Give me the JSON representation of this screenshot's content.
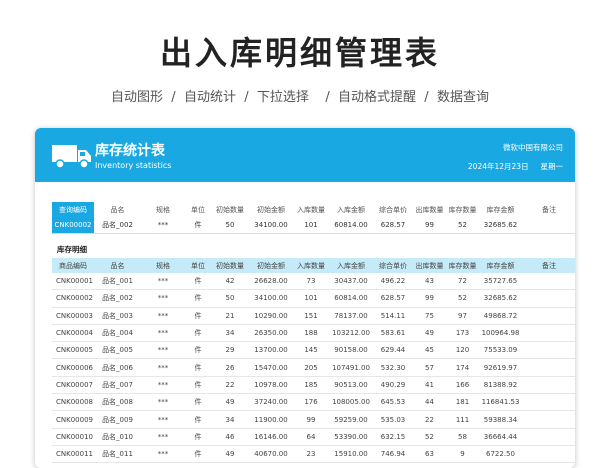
{
  "title": "出入库明细管理表",
  "subtitle": "自动图形  /  自动统计  /  下拉选择    /  自动格式提醒  /  数据查询",
  "header": {
    "title": "库存统计表",
    "subtitle": "Inventory statistics",
    "company": "微软中国有限公司",
    "date": "2024年12月23日     星期一",
    "icon": "truck-icon",
    "color": "#1aa8e3"
  },
  "query": {
    "columns": [
      "查询编码",
      "品名",
      "规格",
      "单位",
      "初始数量",
      "初始金额",
      "入库数量",
      "入库金额",
      "综合单价",
      "出库数量",
      "库存数量",
      "库存金额",
      "备注"
    ],
    "row": [
      "CNK00002",
      "品名_002",
      "***",
      "件",
      "50",
      "34100.00",
      "101",
      "60814.00",
      "628.57",
      "99",
      "52",
      "32685.62",
      ""
    ]
  },
  "detail": {
    "section_title": "库存明细",
    "columns": [
      "商品编码",
      "品名",
      "规格",
      "单位",
      "初始数量",
      "初始金额",
      "入库数量",
      "入库金额",
      "综合单价",
      "出库数量",
      "库存数量",
      "库存金额",
      "备注"
    ],
    "rows": [
      [
        "CNK00001",
        "品名_001",
        "***",
        "件",
        "42",
        "26628.00",
        "73",
        "30437.00",
        "496.22",
        "43",
        "72",
        "35727.65",
        ""
      ],
      [
        "CNK00002",
        "品名_002",
        "***",
        "件",
        "50",
        "34100.00",
        "101",
        "60814.00",
        "628.57",
        "99",
        "52",
        "32685.62",
        ""
      ],
      [
        "CNK00003",
        "品名_003",
        "***",
        "件",
        "21",
        "10290.00",
        "151",
        "78137.00",
        "514.11",
        "75",
        "97",
        "49868.72",
        ""
      ],
      [
        "CNK00004",
        "品名_004",
        "***",
        "件",
        "34",
        "26350.00",
        "188",
        "103212.00",
        "583.61",
        "49",
        "173",
        "100964.98",
        ""
      ],
      [
        "CNK00005",
        "品名_005",
        "***",
        "件",
        "29",
        "13700.00",
        "145",
        "90158.00",
        "629.44",
        "45",
        "120",
        "75533.09",
        ""
      ],
      [
        "CNK00006",
        "品名_006",
        "***",
        "件",
        "26",
        "15470.00",
        "205",
        "107491.00",
        "532.30",
        "57",
        "174",
        "92619.97",
        ""
      ],
      [
        "CNK00007",
        "品名_007",
        "***",
        "件",
        "22",
        "10978.00",
        "185",
        "90513.00",
        "490.29",
        "41",
        "166",
        "81388.92",
        ""
      ],
      [
        "CNK00008",
        "品名_008",
        "***",
        "件",
        "49",
        "37240.00",
        "176",
        "108005.00",
        "645.53",
        "44",
        "181",
        "116841.53",
        ""
      ],
      [
        "CNK00009",
        "品名_009",
        "***",
        "件",
        "34",
        "11900.00",
        "99",
        "59259.00",
        "535.03",
        "22",
        "111",
        "59388.34",
        ""
      ],
      [
        "CNK00010",
        "品名_010",
        "***",
        "件",
        "46",
        "16146.00",
        "64",
        "53390.00",
        "632.15",
        "52",
        "58",
        "36664.44",
        ""
      ],
      [
        "CNK00011",
        "品名_011",
        "***",
        "件",
        "49",
        "40670.00",
        "23",
        "15910.00",
        "746.94",
        "63",
        "9",
        "6722.50",
        ""
      ]
    ]
  }
}
